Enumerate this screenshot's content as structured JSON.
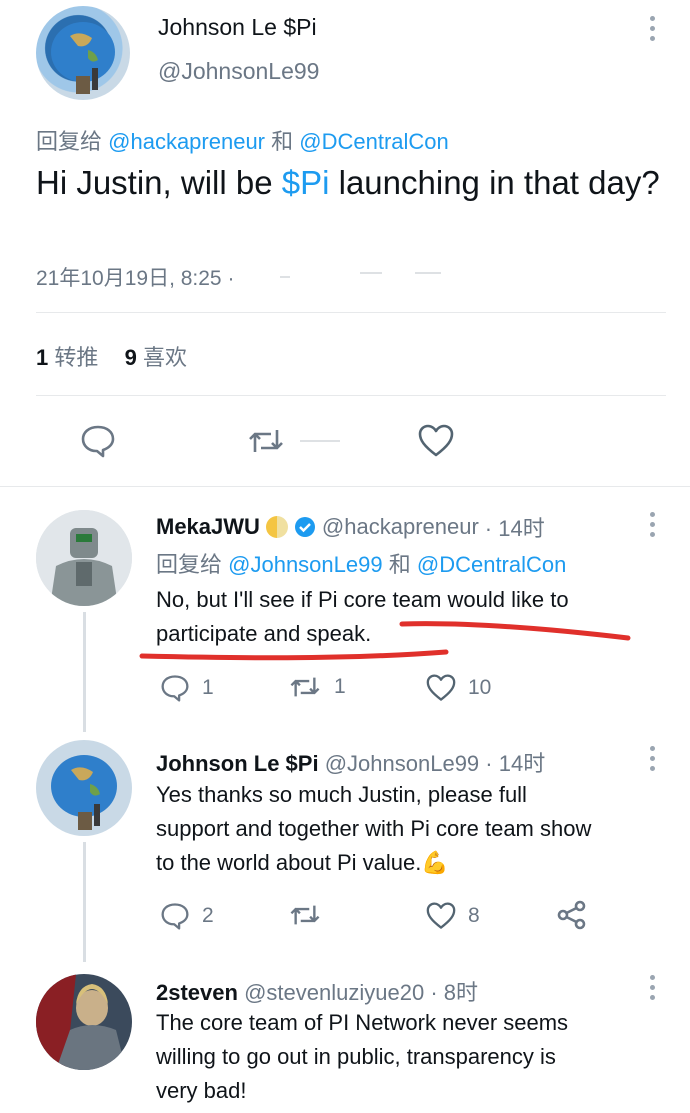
{
  "main_tweet": {
    "author_name": "Johnson Le $Pi",
    "handle": "@JohnsonLe99",
    "reply_prefix": "回复给",
    "reply_to_1": "@hackapreneur",
    "reply_and": "和",
    "reply_to_2": "@DCentralCon",
    "text_before": "Hi Justin, will be",
    "text_cashtag": "$Pi",
    "text_after": "launching in that day?",
    "timestamp": "21年10月19日, 8:25",
    "timestamp_sep": "·",
    "retweets_count": "1",
    "retweets_label": "转推",
    "likes_count": "9",
    "likes_label": "喜欢"
  },
  "replies": [
    {
      "author_name": "MekaJWU",
      "verified": true,
      "handle": "@hackapreneur",
      "time": "· 14时",
      "reply_prefix": "回复给",
      "reply_to_1": "@JohnsonLe99",
      "reply_and": "和",
      "reply_to_2": "@DCentralCon",
      "text_line1": "No, but I'll see if Pi core team would like to",
      "text_line2": "participate and speak.",
      "replies_count": "1",
      "retweets_count": "1",
      "likes_count": "10"
    },
    {
      "author_name": "Johnson Le $Pi",
      "handle": "@JohnsonLe99",
      "time": "· 14时",
      "text_line1": "Yes thanks so much Justin, please full",
      "text_line2": "support and together with Pi core team show",
      "text_line3": "to the world about Pi value.",
      "emoji": "💪",
      "replies_count": "2",
      "likes_count": "8"
    },
    {
      "author_name": "2steven",
      "handle": "@stevenluziyue20",
      "time": "· 8时",
      "text_line1": "The core team of PI Network never seems",
      "text_line2": "willing to go out in public, transparency is",
      "text_line3": "very bad!"
    }
  ],
  "colors": {
    "link": "#1d9bf0",
    "secondary_text": "#6b7785",
    "annotation_red": "#e0302b",
    "like_icon": "#536471"
  },
  "icons": [
    "more-vert-icon",
    "reply-icon",
    "retweet-icon",
    "like-icon",
    "share-icon",
    "verified-badge-icon",
    "moon-emoji-icon",
    "flex-emoji-icon"
  ]
}
